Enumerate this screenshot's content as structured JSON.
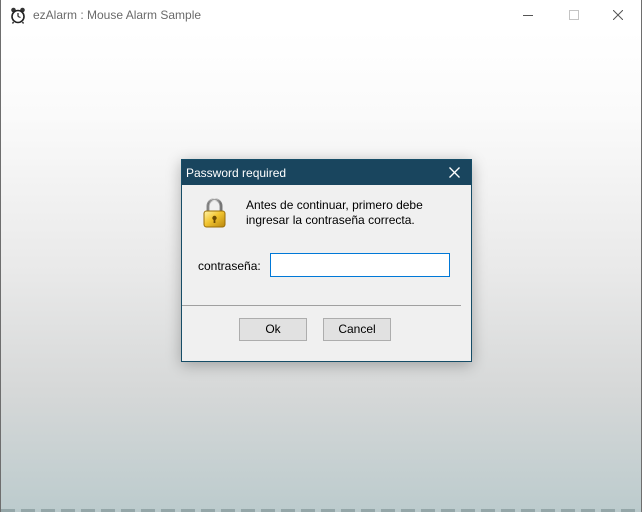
{
  "window": {
    "title": "ezAlarm : Mouse Alarm Sample",
    "app_icon": "alarm-clock-icon",
    "controls": [
      "minimize-icon",
      "maximize-icon",
      "close-icon"
    ]
  },
  "dialog": {
    "title": "Password required",
    "close_icon": "close-icon",
    "lock_icon": "padlock-icon",
    "message_line1": "Antes de continuar, primero debe",
    "message_line2": "ingresar la contraseña correcta.",
    "password_label": "contraseña:",
    "password_value": "",
    "ok_label": "Ok",
    "cancel_label": "Cancel"
  },
  "colors": {
    "dialog_titlebar": "#19455e",
    "dialog_background": "#f0f0f0",
    "input_focus_border": "#0078d7"
  }
}
